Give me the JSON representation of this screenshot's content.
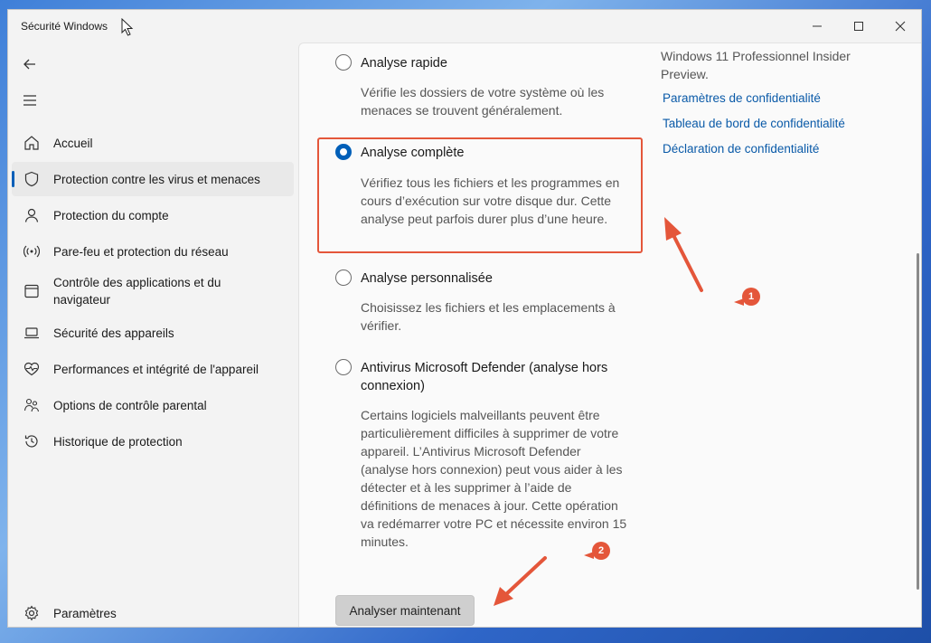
{
  "window": {
    "title": "Sécurité Windows"
  },
  "sidebar": {
    "items": [
      {
        "label": "Accueil",
        "icon": "home-icon"
      },
      {
        "label": "Protection contre les virus et menaces",
        "icon": "shield-icon",
        "active": true
      },
      {
        "label": "Protection du compte",
        "icon": "person-icon"
      },
      {
        "label": "Pare-feu et protection du réseau",
        "icon": "wifi-icon"
      },
      {
        "label": "Contrôle des applications et du navigateur",
        "icon": "browser-icon"
      },
      {
        "label": "Sécurité des appareils",
        "icon": "laptop-icon"
      },
      {
        "label": "Performances et intégrité de l'appareil",
        "icon": "heart-pulse-icon"
      },
      {
        "label": "Options de contrôle parental",
        "icon": "family-icon"
      },
      {
        "label": "Historique de protection",
        "icon": "history-icon"
      }
    ],
    "settings_label": "Paramètres"
  },
  "main": {
    "options": [
      {
        "title": "Analyse rapide",
        "desc": "Vérifie les dossiers de votre système où les menaces se trouvent généralement.",
        "checked": false
      },
      {
        "title": "Analyse complète",
        "desc": "Vérifiez tous les fichiers et les programmes en cours d’exécution sur votre disque dur. Cette analyse peut parfois durer plus d’une heure.",
        "checked": true
      },
      {
        "title": "Analyse personnalisée",
        "desc": "Choisissez les fichiers et les emplacements à vérifier.",
        "checked": false
      },
      {
        "title": "Antivirus Microsoft Defender (analyse hors connexion)",
        "desc": "Certains logiciels malveillants peuvent être particulièrement difficiles à supprimer de votre appareil. L’Antivirus Microsoft Defender (analyse hors connexion) peut vous aider à les détecter et à les supprimer à l’aide de définitions de menaces à jour. Cette opération va redémarrer votre PC et nécessite environ 15 minutes.",
        "checked": false
      }
    ],
    "scan_button": "Analyser maintenant"
  },
  "right": {
    "os_text": "Windows 11 Professionnel Insider Preview.",
    "links": [
      "Paramètres de confidentialité",
      "Tableau de bord de confidentialité",
      "Déclaration de confidentialité"
    ]
  },
  "annotations": {
    "badge1": "1",
    "badge2": "2",
    "color": "#e4563a"
  },
  "colors": {
    "accent": "#005fb8",
    "link": "#0a5aa8"
  }
}
